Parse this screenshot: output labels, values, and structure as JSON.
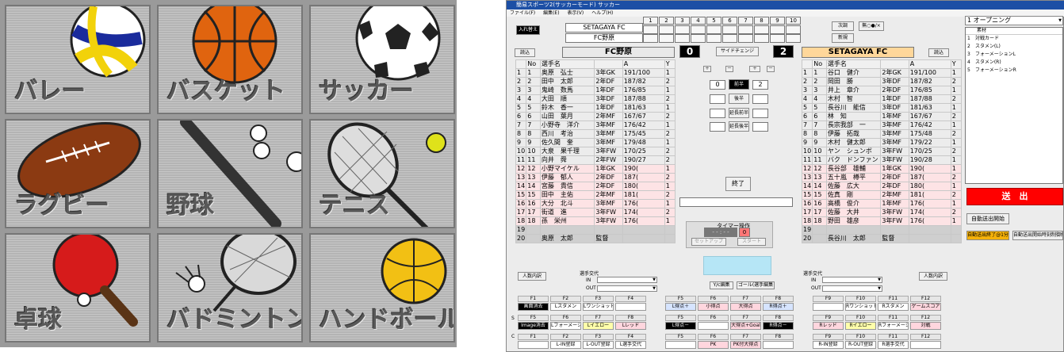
{
  "tiles": [
    {
      "label": "バレー"
    },
    {
      "label": "バスケット"
    },
    {
      "label": "サッカー"
    },
    {
      "label": "ラグビー"
    },
    {
      "label": "野球"
    },
    {
      "label": "テニス"
    },
    {
      "label": "卓球"
    },
    {
      "label": "バドミントン"
    },
    {
      "label": "ハンドボール"
    }
  ],
  "app": {
    "title": "簡易スポーツ2(サッカーモード)  サッカー",
    "menu": [
      "ファイル(F)",
      "編集(E)",
      "表示(V)",
      "ヘルプ(H)"
    ],
    "swap_button": "入れ替え",
    "score_header_team1": "SETAGAYA FC",
    "score_header_team2": "FC野原",
    "innings": [
      "1",
      "2",
      "3",
      "4",
      "5",
      "6",
      "7",
      "8",
      "9",
      "10"
    ],
    "next_button": "次調",
    "edit_button": "新規",
    "mode_button": "無○●/×",
    "load_left": "読込",
    "load_right": "読込",
    "team_left": "FC野原",
    "team_right": "SETAGAYA FC",
    "score_left": "0",
    "score_right": "2",
    "side_change": "サイドチェンジ",
    "plus_minus": [
      "＋",
      "－",
      "＋",
      "－"
    ],
    "half_labels": [
      "前半",
      "後半",
      "延長前半",
      "延長後半"
    ],
    "half_left_first": "0",
    "half_right_first": "2",
    "end_button": "終了",
    "timer_label": "タイマー操作",
    "timer_value": "- - : - -",
    "timer_red": "0",
    "timer_setup": "セットアップ",
    "timer_start": "スタート",
    "yc_button": "Y/c編集",
    "goal_button": "ゴール(選手編集",
    "member_swap_label": "選手交代",
    "in_label": "IN",
    "out_label": "OUT",
    "member_order_left": "人数内訳",
    "member_order_right": "人数内訳",
    "roster_headers": [
      "No",
      "選手名",
      "A",
      "Y"
    ],
    "left_roster": [
      [
        "1",
        "1",
        "奥原　弘士",
        "3年GK",
        "191/100",
        "1"
      ],
      [
        "2",
        "2",
        "田中　太郎",
        "2年DF",
        "187/82",
        "2"
      ],
      [
        "3",
        "3",
        "鬼崎　数馬",
        "1年DF",
        "176/85",
        "1"
      ],
      [
        "4",
        "4",
        "大田　順",
        "3年DF",
        "187/88",
        "2"
      ],
      [
        "5",
        "5",
        "鈴木　香一",
        "1年DF",
        "181/63",
        "1"
      ],
      [
        "6",
        "6",
        "山田　葉月",
        "2年MF",
        "167/67",
        "2"
      ],
      [
        "7",
        "7",
        "小野寺　洋介",
        "3年MF",
        "176/42",
        "1"
      ],
      [
        "8",
        "8",
        "西川　考治",
        "3年MF",
        "175/45",
        "2"
      ],
      [
        "9",
        "9",
        "佐久間　奎",
        "3年MF",
        "179/48",
        "1"
      ],
      [
        "10",
        "10",
        "大泉　果千理",
        "3年FW",
        "170/25",
        "2"
      ],
      [
        "11",
        "11",
        "向井　舜",
        "2年FW",
        "190/27",
        "2"
      ],
      [
        "12",
        "12",
        "小野マイケル",
        "1年GK",
        "190(",
        "1"
      ],
      [
        "13",
        "13",
        "伊藤　郁人",
        "2年DF",
        "187(",
        "2"
      ],
      [
        "14",
        "14",
        "宮藤　貴信",
        "2年DF",
        "180(",
        "1"
      ],
      [
        "15",
        "15",
        "田中　主佑",
        "2年MF",
        "181(",
        "2"
      ],
      [
        "16",
        "16",
        "大分　北斗",
        "3年MF",
        "176(",
        "1"
      ],
      [
        "17",
        "17",
        "街道　進",
        "3年FW",
        "174(",
        "2"
      ],
      [
        "18",
        "18",
        "孫　栄州",
        "3年FW",
        "176(",
        "1"
      ],
      [
        "19",
        "",
        "",
        "",
        "",
        ""
      ],
      [
        "20",
        "",
        "奥原　太郎",
        "監督",
        "",
        ""
      ]
    ],
    "right_roster": [
      [
        "1",
        "1",
        "谷口　健介",
        "2年GK",
        "191/100",
        "1"
      ],
      [
        "2",
        "2",
        "岡田　勝",
        "3年DF",
        "187/82",
        "2"
      ],
      [
        "3",
        "3",
        "井上　章介",
        "2年DF",
        "176/85",
        "1"
      ],
      [
        "4",
        "4",
        "木村　智",
        "1年DF",
        "187/88",
        "2"
      ],
      [
        "5",
        "5",
        "長谷川　能信",
        "3年DF",
        "181/63",
        "1"
      ],
      [
        "6",
        "6",
        "林　知",
        "1年MF",
        "167/67",
        "2"
      ],
      [
        "7",
        "7",
        "長宗我部　一",
        "3年MF",
        "176/42",
        "1"
      ],
      [
        "8",
        "8",
        "伊藤　拓哉",
        "3年MF",
        "175/48",
        "2"
      ],
      [
        "9",
        "9",
        "木村　健太郎",
        "3年MF",
        "179/22",
        "1"
      ],
      [
        "10",
        "10",
        "ヤン　シュンボ",
        "3年FW",
        "170/25",
        "2"
      ],
      [
        "11",
        "11",
        "バク　ドンファン",
        "3年FW",
        "190/28",
        "1"
      ],
      [
        "12",
        "12",
        "長谷部　雄輔",
        "1年GK",
        "190(",
        "1"
      ],
      [
        "13",
        "13",
        "五十嵐　樽平",
        "2年DF",
        "187(",
        "2"
      ],
      [
        "14",
        "14",
        "佐藤　広大",
        "2年DF",
        "180(",
        "1"
      ],
      [
        "15",
        "15",
        "佐真　剛",
        "2年MF",
        "181(",
        "2"
      ],
      [
        "16",
        "16",
        "高橋　俊介",
        "1年MF",
        "176(",
        "1"
      ],
      [
        "17",
        "17",
        "佐藤　大井",
        "3年FW",
        "174(",
        "2"
      ],
      [
        "18",
        "18",
        "野田　雄彦",
        "3年FW",
        "176(",
        "1"
      ],
      [
        "19",
        "",
        "",
        "",
        "",
        ""
      ],
      [
        "20",
        "",
        "長谷川　太郎",
        "監督",
        "",
        ""
      ]
    ],
    "fkeys_left": {
      "heads1": [
        "F1",
        "F2",
        "F3",
        "F4"
      ],
      "row1": [
        "画面消去",
        "Lスタメン",
        "Lワンショット",
        ""
      ],
      "heads2": [
        "F5",
        "F6",
        "F7",
        "F8"
      ],
      "row2": [
        "Image消去",
        "Lフォーメーション",
        "Lイエロー",
        "Lレッド"
      ],
      "heads3": [
        "F1",
        "F2",
        "F3",
        "F4"
      ],
      "row3": [
        "",
        "L-IN登録",
        "L-OUT登録",
        "L選手交代"
      ]
    },
    "fkeys_mid": {
      "heads1": [
        "F5",
        "F6",
        "F7",
        "F8"
      ],
      "row1": [
        "L得点＋",
        "小得点",
        "大得点",
        "R得点＋"
      ],
      "heads2": [
        "F5",
        "F6",
        "F7",
        "F8"
      ],
      "row2": [
        "L得点－",
        "",
        "大得点+Goal",
        "R得点－"
      ],
      "heads3": [
        "F5",
        "F6",
        "F7",
        "F8"
      ],
      "row3": [
        "",
        "PK",
        "PK付大得点",
        ""
      ]
    },
    "fkeys_right": {
      "heads1": [
        "F9",
        "F10",
        "F11",
        "F12"
      ],
      "row1": [
        "",
        "Rワンショット",
        "Rスタメン",
        "ゲームスコア"
      ],
      "heads2": [
        "F9",
        "F10",
        "F11",
        "F12"
      ],
      "row2": [
        "Rレッド",
        "Rイエロー",
        "Rフォーメーション",
        "対戦"
      ],
      "heads3": [
        "F9",
        "F10",
        "F11",
        "F12"
      ],
      "row3": [
        "R-IN登録",
        "R-OUT登録",
        "R選手交代",
        ""
      ]
    },
    "side_letters": [
      "S",
      "C"
    ],
    "opening_select": "1 オープニング",
    "material_header": "素材",
    "materials": [
      [
        "1",
        "対戦カード"
      ],
      [
        "2",
        "スタメン(L)"
      ],
      [
        "3",
        "フォーメーションL"
      ],
      [
        "4",
        "スタメン(R)"
      ],
      [
        "5",
        "フォーメーションR"
      ]
    ],
    "send_button": "送　出",
    "auto_send_start": "自動送出開始",
    "auto_send_end1": "自動送出終了@1分",
    "auto_send_end2": "自動送出開始時刻制御終了"
  },
  "colors": {
    "send": "#ff0000",
    "titlebar": "#1c4fa5",
    "sub_row": "#fde3e5",
    "team_right": "#ffd79a"
  }
}
